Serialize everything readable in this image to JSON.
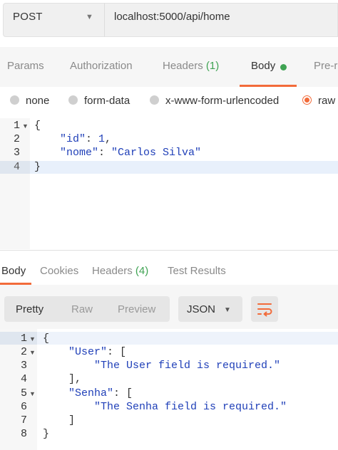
{
  "request": {
    "method": "POST",
    "url": "localhost:5000/api/home"
  },
  "req_tabs": {
    "params": "Params",
    "authorization": "Authorization",
    "headers": "Headers",
    "headers_count": "(1)",
    "body": "Body",
    "pre_request": "Pre-r"
  },
  "body_types": {
    "none": "none",
    "form_data": "form-data",
    "urlencoded": "x-www-form-urlencoded",
    "raw": "raw",
    "selected": "raw"
  },
  "request_body": {
    "line_numbers": [
      "1",
      "2",
      "3",
      "4"
    ],
    "l1": "{",
    "l2_key": "\"id\"",
    "l2_sep": ": ",
    "l2_val": "1",
    "l2_end": ",",
    "l3_key": "\"nome\"",
    "l3_sep": ": ",
    "l3_val": "\"Carlos Silva\"",
    "l4": "}"
  },
  "resp_tabs": {
    "body": "Body",
    "cookies": "Cookies",
    "headers": "Headers",
    "headers_count": "(4)",
    "test_results": "Test Results"
  },
  "view_modes": {
    "pretty": "Pretty",
    "raw": "Raw",
    "preview": "Preview"
  },
  "format": "JSON",
  "response_body": {
    "line_numbers": [
      "1",
      "2",
      "3",
      "4",
      "5",
      "6",
      "7",
      "8"
    ],
    "l1": "{",
    "l2_key": "\"User\"",
    "l2_rest": ": [",
    "l3": "\"The User field is required.\"",
    "l4": "],",
    "l5_key": "\"Senha\"",
    "l5_rest": ": [",
    "l6": "\"The Senha field is required.\"",
    "l7": "]",
    "l8": "}"
  },
  "colors": {
    "accent": "#f26b3a",
    "dot_green": "#3fa353",
    "json_blue": "#1f3fb8"
  }
}
